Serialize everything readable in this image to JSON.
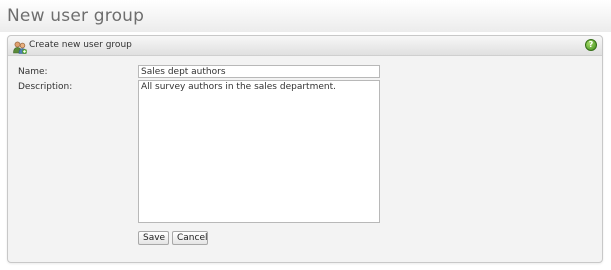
{
  "page": {
    "title": "New user group"
  },
  "panel": {
    "title": "Create new user group",
    "icons": {
      "header": "users-icon",
      "help": "help-icon"
    },
    "help_glyph": "?"
  },
  "form": {
    "name_label": "Name:",
    "name_value": "Sales dept authors",
    "description_label": "Description:",
    "description_value": "All survey authors in the sales department.",
    "save_label": "Save",
    "cancel_label": "Cancel"
  },
  "colors": {
    "help_green": "#4f9e24",
    "title_gray": "#6e6e6e",
    "panel_bg": "#f3f3f3"
  }
}
